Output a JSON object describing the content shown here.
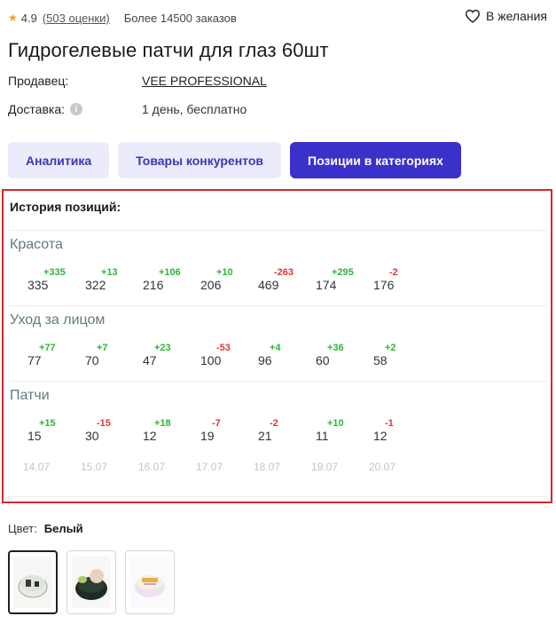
{
  "meta": {
    "rating": "4.9",
    "reviews": "(503 оценки)",
    "orders": "Более 14500 заказов",
    "wishlist_label": "В желания"
  },
  "product": {
    "title": "Гидрогелевые патчи для глаз 60шт",
    "seller_label": "Продавец:",
    "seller_value": "VEE PROFESSIONAL",
    "delivery_label": "Доставка:",
    "delivery_value": "1 день, бесплатно"
  },
  "tabs": [
    {
      "label": "Аналитика",
      "active": false
    },
    {
      "label": "Товары конкурентов",
      "active": false
    },
    {
      "label": "Позиции в категориях",
      "active": true
    }
  ],
  "positions": {
    "title": "История позиций:",
    "categories": [
      {
        "name": "Красота",
        "values": [
          "335",
          "322",
          "216",
          "206",
          "469",
          "174",
          "176"
        ],
        "deltas": [
          "+335",
          "+13",
          "+106",
          "+10",
          "-263",
          "+295",
          "-2"
        ]
      },
      {
        "name": "Уход за лицом",
        "values": [
          "77",
          "70",
          "47",
          "100",
          "96",
          "60",
          "58"
        ],
        "deltas": [
          "+77",
          "+7",
          "+23",
          "-53",
          "+4",
          "+36",
          "+2"
        ]
      },
      {
        "name": "Патчи",
        "values": [
          "15",
          "30",
          "12",
          "19",
          "21",
          "11",
          "12"
        ],
        "deltas": [
          "+15",
          "-15",
          "+18",
          "-7",
          "-2",
          "+10",
          "-1"
        ]
      }
    ],
    "dates": [
      "14.07",
      "15.07",
      "16.07",
      "17.07",
      "18.07",
      "19.07",
      "20.07"
    ]
  },
  "color": {
    "label": "Цвет:",
    "value": "Белый"
  },
  "colors": {
    "accent": "#3b30c9",
    "tab_bg": "#ecebfb",
    "up": "#2bb534",
    "down": "#e03535",
    "panel_border": "#d8262e"
  }
}
